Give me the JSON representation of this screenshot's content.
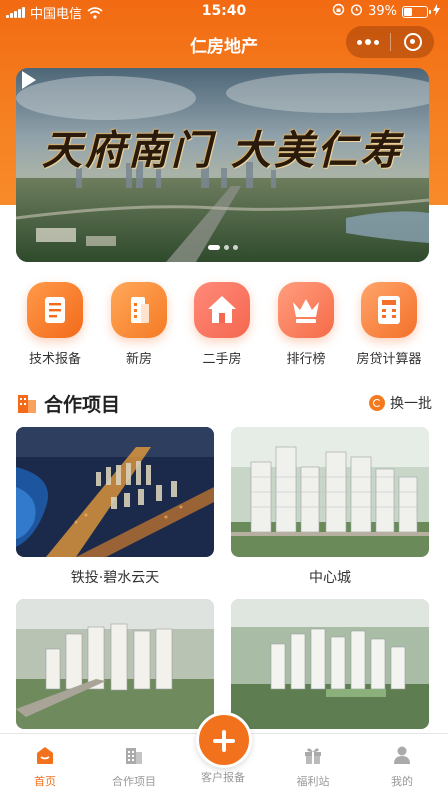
{
  "status_bar": {
    "carrier": "中国电信",
    "time": "15:40",
    "battery": "39%",
    "battery_level": 0.39
  },
  "nav": {
    "title": "仁房地产",
    "more_icon": "more-dots-icon",
    "close_icon": "target-close-icon"
  },
  "banner": {
    "headline": "天府南门  大美仁寿",
    "slide_count": 3,
    "active_slide": 1
  },
  "menu": [
    {
      "label": "技术报备",
      "icon": "document-icon"
    },
    {
      "label": "新房",
      "icon": "building-icon"
    },
    {
      "label": "二手房",
      "icon": "house-icon"
    },
    {
      "label": "排行榜",
      "icon": "crown-icon"
    },
    {
      "label": "房贷计算器",
      "icon": "calculator-icon"
    }
  ],
  "section": {
    "title": "合作项目",
    "refresh_label": "换一批"
  },
  "projects": [
    {
      "name": "铁投·碧水云天"
    },
    {
      "name": "中心城"
    },
    {
      "name": ""
    },
    {
      "name": ""
    }
  ],
  "tabbar": [
    {
      "label": "首页",
      "icon": "home-icon",
      "active": true
    },
    {
      "label": "合作项目",
      "icon": "office-building-icon",
      "active": false
    },
    {
      "label": "客户报备",
      "icon": "plus-icon",
      "active": false
    },
    {
      "label": "福利站",
      "icon": "gift-icon",
      "active": false
    },
    {
      "label": "我的",
      "icon": "user-icon",
      "active": false
    }
  ],
  "colors": {
    "brand": "#f2711c",
    "header_bg": "#f26a12",
    "tab_inactive": "#999999"
  }
}
